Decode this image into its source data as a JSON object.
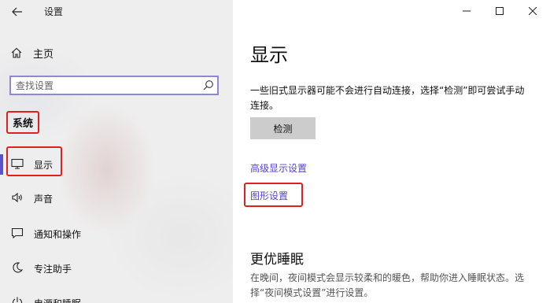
{
  "window": {
    "app_title": "设置",
    "controls": [
      "minimize-icon",
      "maximize-icon",
      "close-icon"
    ]
  },
  "sidebar": {
    "home_label": "主页",
    "search_placeholder": "查找设置",
    "section_label": "系统",
    "items": [
      {
        "label": "显示",
        "icon": "monitor-icon",
        "active": true
      },
      {
        "label": "声音",
        "icon": "speaker-icon"
      },
      {
        "label": "通知和操作",
        "icon": "message-icon"
      },
      {
        "label": "专注助手",
        "icon": "moon-icon"
      },
      {
        "label": "电源和睡眠",
        "icon": "power-icon"
      }
    ]
  },
  "main": {
    "title": "显示",
    "description": "一些旧式显示器可能不会进行自动连接，选择“检测”即可尝试手动连接。",
    "detect_button": "检测",
    "links": [
      "高级显示设置",
      "图形设置"
    ],
    "sleep_title": "更优睡眠",
    "sleep_description": "在晚间，夜间模式会显示较柔和的暖色，帮助你进入睡眠状态。选择“夜间模式设置”进行设置。"
  },
  "colors": {
    "accent": "#5a52c8",
    "link": "#5246c6",
    "highlight_box": "#e02020",
    "sidebar_bg": "#efeeee",
    "button_bg": "#cccccc"
  }
}
